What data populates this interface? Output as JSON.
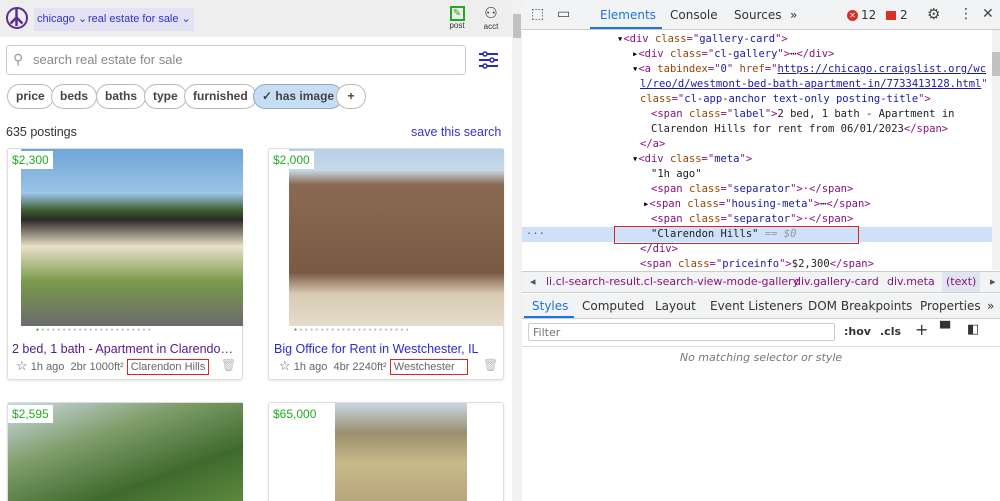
{
  "header": {
    "city": "chicago",
    "category": "real estate for sale",
    "post_label": "post",
    "acct_label": "acct"
  },
  "search": {
    "placeholder": "search real estate for sale"
  },
  "filters": [
    "price",
    "beds",
    "baths",
    "type",
    "furnished",
    "✓ has image",
    "+"
  ],
  "results": {
    "count": "635 postings",
    "save_label": "save this search"
  },
  "listings": [
    {
      "price": "$2,300",
      "title": "2 bed, 1 bath - Apartment in Clarendon Hills for rent from 06/01/2023",
      "age": "1h ago",
      "br": "2br",
      "sqft": "1000ft²",
      "location": "Clarendon Hills"
    },
    {
      "price": "$2,000",
      "title": "Big Office for Rent in Westchester, IL",
      "age": "1h ago",
      "br": "4br",
      "sqft": "2240ft²",
      "location": "Westchester"
    },
    {
      "price": "$2,595"
    },
    {
      "price": "$65,000"
    }
  ],
  "devtools": {
    "tabs": [
      "Elements",
      "Console",
      "Sources",
      "»"
    ],
    "errors": "12",
    "warnings": "2",
    "dom": {
      "l1": "div",
      "l1c": "gallery-card",
      "l2c": "cl-gallery",
      "href1": "https://chicago.craigslist.org/wc",
      "href2": "l/reo/d/westmont-bed-bath-apartment-in/7733413128.html",
      "aclass": "cl-app-anchor text-only posting-title",
      "label1": "2 bed, 1 bath - Apartment in",
      "label2": "Clarendon Hills for rent from 06/01/2023",
      "metac": "meta",
      "age": "\"1h ago\"",
      "sep": "separator",
      "hm": "housing-meta",
      "selected": "\"Clarendon Hills\"",
      "dollar": "== $0",
      "pi": "priceinfo",
      "price": "$2,300"
    },
    "breadcrumbs": [
      "li.cl-search-result.cl-search-view-mode-gallery",
      "div.gallery-card",
      "div.meta",
      "(text)"
    ],
    "style_tabs": [
      "Styles",
      "Computed",
      "Layout",
      "Event Listeners",
      "DOM Breakpoints",
      "Properties",
      "»"
    ],
    "filter_placeholder": "Filter",
    "hov": ":hov",
    "cls": ".cls",
    "empty": "No matching selector or style"
  }
}
